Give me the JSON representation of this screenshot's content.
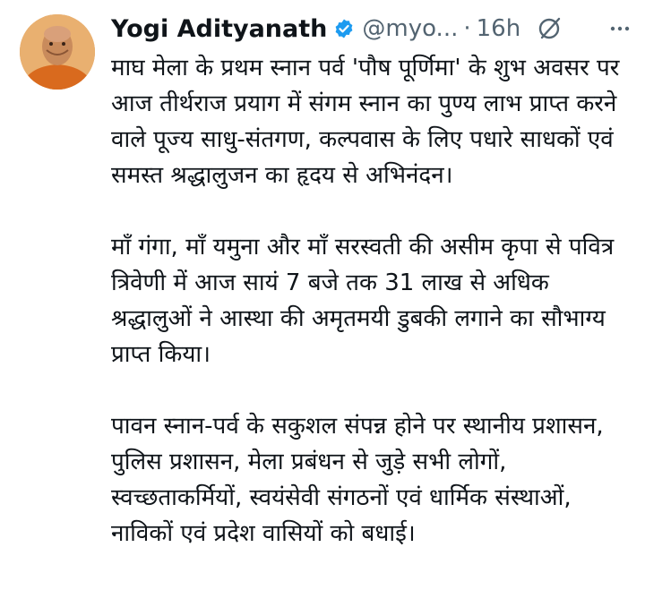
{
  "author": {
    "display_name": "Yogi Adityanath",
    "handle": "@myo...",
    "verified": true,
    "verified_color": "#1d9bf0",
    "avatar_icon": "profile-photo"
  },
  "meta": {
    "separator": "·",
    "time": "16h",
    "grok_icon": "grok-icon",
    "more_icon": "more-icon"
  },
  "tweet": {
    "paragraphs": [
      "माघ मेला के प्रथम स्नान पर्व 'पौष पूर्णिमा' के शुभ अवसर पर आज तीर्थराज प्रयाग में संगम स्नान का पुण्य लाभ प्राप्त करने वाले पूज्य साधु-संतगण, कल्पवास के लिए पधारे साधकों एवं समस्त श्रद्धालुजन का हृदय से अभिनंदन।",
      "माँ गंगा, माँ यमुना और माँ सरस्वती की असीम कृपा से पवित्र त्रिवेणी में आज सायं 7  बजे तक 31 लाख से अधिक श्रद्धालुओं ने आस्था की अमृतमयी डुबकी लगाने का सौभाग्य प्राप्त किया।",
      "पावन स्नान-पर्व के सकुशल संपन्न होने पर स्थानीय प्रशासन, पुलिस प्रशासन, मेला प्रबंधन से जुड़े सभी लोगों, स्वच्छताकर्मियों, स्वयंसेवी संगठनों एवं धार्मिक संस्थाओं, नाविकों एवं प्रदेश वासियों को बधाई।"
    ]
  }
}
